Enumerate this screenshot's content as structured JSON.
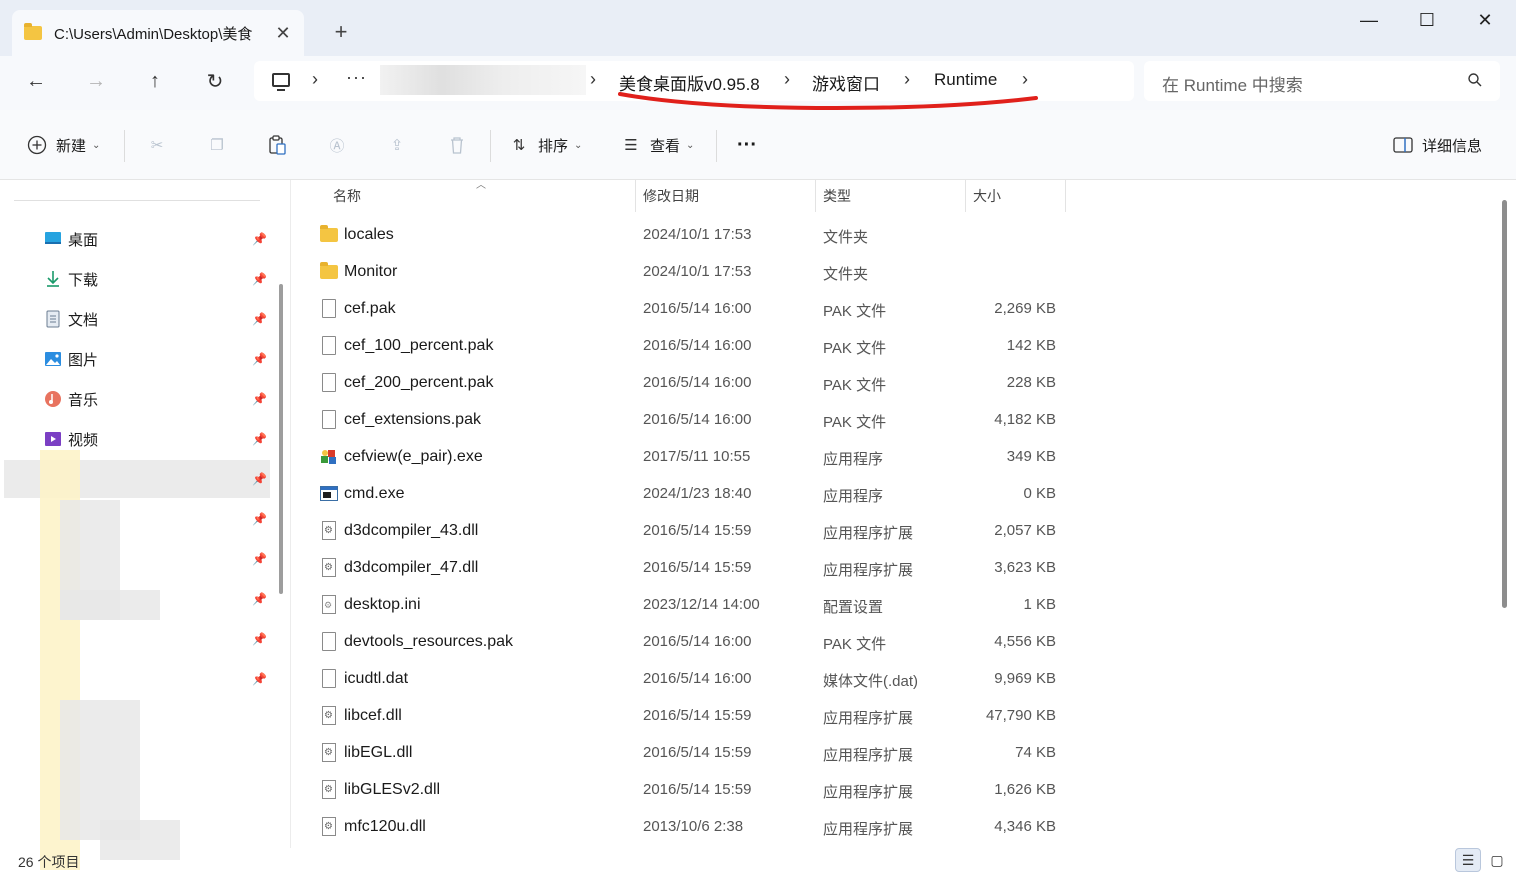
{
  "window": {
    "tab_title": "C:\\Users\\Admin\\Desktop\\美食",
    "new_tab": "+",
    "close_tab": "✕",
    "minimize": "—",
    "maximize": "☐",
    "close": "✕"
  },
  "nav": {
    "back": "←",
    "forward": "→",
    "up": "↑",
    "refresh": "↻",
    "more": "···",
    "breadcrumb": [
      "美食桌面版v0.95.8",
      "游戏窗口",
      "Runtime"
    ],
    "separator": "›"
  },
  "search": {
    "placeholder": "在 Runtime 中搜索"
  },
  "toolbar": {
    "new_label": "新建",
    "sort_label": "排序",
    "view_label": "查看",
    "more": "···",
    "details_label": "详细信息"
  },
  "sidebar": {
    "items": [
      {
        "label": "桌面",
        "icon": "desktop-icon"
      },
      {
        "label": "下载",
        "icon": "download-icon"
      },
      {
        "label": "文档",
        "icon": "document-icon"
      },
      {
        "label": "图片",
        "icon": "picture-icon"
      },
      {
        "label": "音乐",
        "icon": "music-icon"
      },
      {
        "label": "视频",
        "icon": "video-icon"
      }
    ],
    "status": "26 个项目"
  },
  "columns": {
    "name": "名称",
    "date": "修改日期",
    "type": "类型",
    "size": "大小"
  },
  "files": [
    {
      "name": "locales",
      "date": "2024/10/1 17:53",
      "type": "文件夹",
      "size": "",
      "icon": "folder"
    },
    {
      "name": "Monitor",
      "date": "2024/10/1 17:53",
      "type": "文件夹",
      "size": "",
      "icon": "folder"
    },
    {
      "name": "cef.pak",
      "date": "2016/5/14 16:00",
      "type": "PAK 文件",
      "size": "2,269 KB",
      "icon": "file"
    },
    {
      "name": "cef_100_percent.pak",
      "date": "2016/5/14 16:00",
      "type": "PAK 文件",
      "size": "142 KB",
      "icon": "file"
    },
    {
      "name": "cef_200_percent.pak",
      "date": "2016/5/14 16:00",
      "type": "PAK 文件",
      "size": "228 KB",
      "icon": "file"
    },
    {
      "name": "cef_extensions.pak",
      "date": "2016/5/14 16:00",
      "type": "PAK 文件",
      "size": "4,182 KB",
      "icon": "file"
    },
    {
      "name": "cefview(e_pair).exe",
      "date": "2017/5/11 10:55",
      "type": "应用程序",
      "size": "349 KB",
      "icon": "app"
    },
    {
      "name": "cmd.exe",
      "date": "2024/1/23 18:40",
      "type": "应用程序",
      "size": "0 KB",
      "icon": "exe"
    },
    {
      "name": "d3dcompiler_43.dll",
      "date": "2016/5/14 15:59",
      "type": "应用程序扩展",
      "size": "2,057 KB",
      "icon": "dll"
    },
    {
      "name": "d3dcompiler_47.dll",
      "date": "2016/5/14 15:59",
      "type": "应用程序扩展",
      "size": "3,623 KB",
      "icon": "dll"
    },
    {
      "name": "desktop.ini",
      "date": "2023/12/14 14:00",
      "type": "配置设置",
      "size": "1 KB",
      "icon": "ini"
    },
    {
      "name": "devtools_resources.pak",
      "date": "2016/5/14 16:00",
      "type": "PAK 文件",
      "size": "4,556 KB",
      "icon": "file"
    },
    {
      "name": "icudtl.dat",
      "date": "2016/5/14 16:00",
      "type": "媒体文件(.dat)",
      "size": "9,969 KB",
      "icon": "file"
    },
    {
      "name": "libcef.dll",
      "date": "2016/5/14 15:59",
      "type": "应用程序扩展",
      "size": "47,790 KB",
      "icon": "dll"
    },
    {
      "name": "libEGL.dll",
      "date": "2016/5/14 15:59",
      "type": "应用程序扩展",
      "size": "74 KB",
      "icon": "dll"
    },
    {
      "name": "libGLESv2.dll",
      "date": "2016/5/14 15:59",
      "type": "应用程序扩展",
      "size": "1,626 KB",
      "icon": "dll"
    },
    {
      "name": "mfc120u.dll",
      "date": "2013/10/6 2:38",
      "type": "应用程序扩展",
      "size": "4,346 KB",
      "icon": "dll"
    }
  ],
  "colors": {
    "annotation": "#e0201b",
    "titlebar": "#e9eef6",
    "accent": "#2f6fc1"
  }
}
